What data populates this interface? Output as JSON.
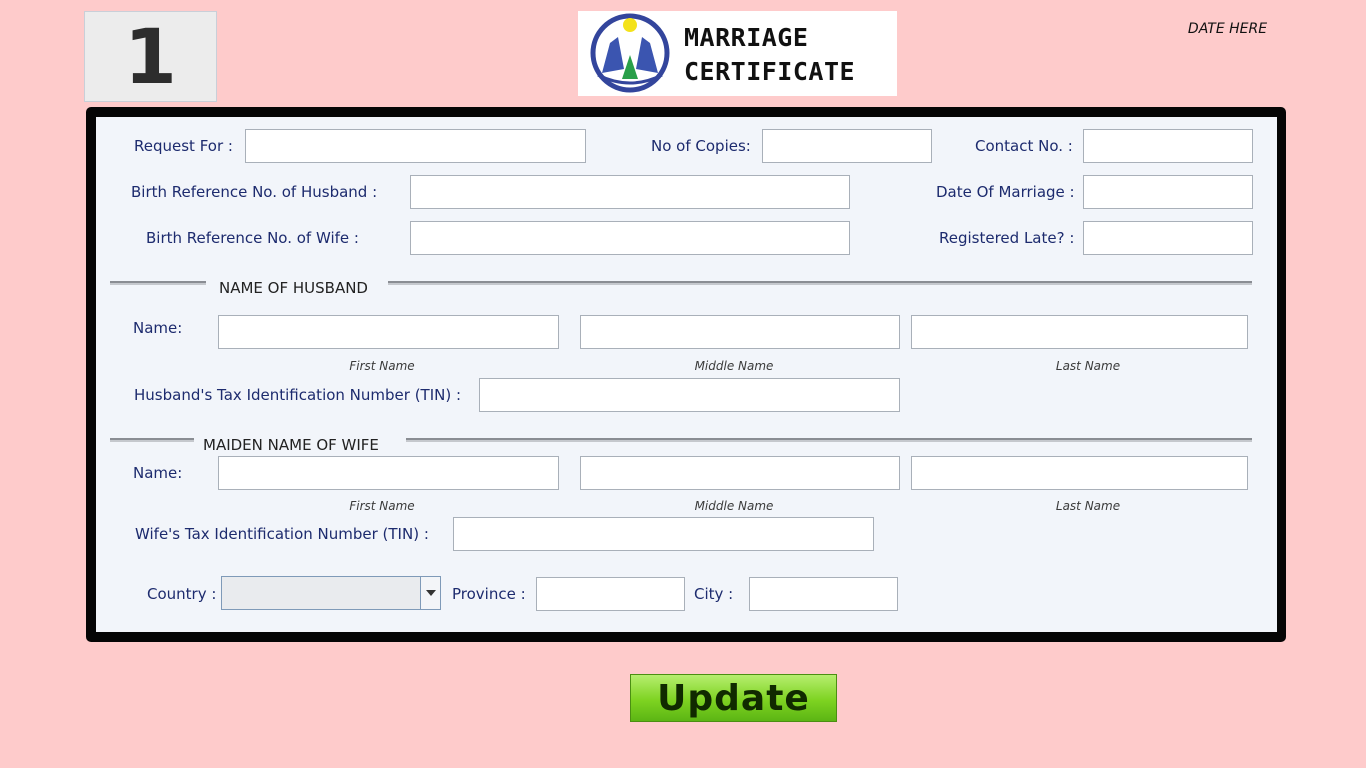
{
  "header": {
    "step_number": "1",
    "logo_line1": "MARRIAGE",
    "logo_line2": "CERTIFICATE",
    "date_label": "DATE HERE"
  },
  "form": {
    "request_for_label": "Request For :",
    "copies_label": "No of Copies:",
    "contact_label": "Contact No. :",
    "husband_birth_ref_label": "Birth Reference No. of Husband :",
    "date_of_marriage_label": "Date Of Marriage :",
    "wife_birth_ref_label": "Birth Reference No. of Wife :",
    "registered_late_label": "Registered Late? :",
    "husband_section_title": "NAME OF HUSBAND",
    "wife_section_title": "MAIDEN NAME OF WIFE",
    "name_label": "Name:",
    "first_name_caption": "First Name",
    "middle_name_caption": "Middle Name",
    "last_name_caption": "Last Name",
    "husband_tin_label": "Husband's Tax Identification Number (TIN) :",
    "wife_tin_label": "Wife's Tax Identification Number (TIN) :",
    "country_label": "Country :",
    "province_label": "Province :",
    "city_label": "City :"
  },
  "actions": {
    "update_label": "Update"
  },
  "colors": {
    "background": "#fecbcb",
    "panel": "#f2f5fa",
    "label_text": "#1d2b6e",
    "button_green": "#7ed321"
  },
  "icons": {
    "logo": "praying-hands-logo",
    "dropdown": "chevron-down-icon"
  }
}
